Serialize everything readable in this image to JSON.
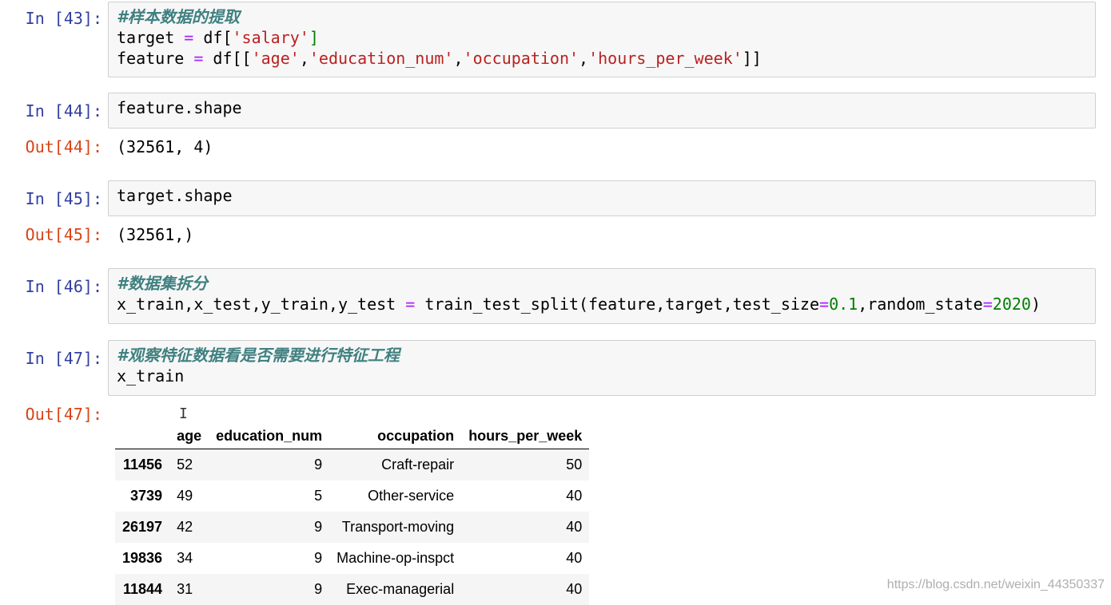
{
  "cells": {
    "c43": {
      "prompt": "In [43]:",
      "comment": "#样本数据的提取",
      "line2": {
        "a": "target ",
        "op": "=",
        "b": " df[",
        "s1": "'salary'",
        "c": "]"
      },
      "line3": {
        "a": "feature ",
        "op": "=",
        "b": " df[[",
        "s1": "'age'",
        "s2": "'education_num'",
        "s3": "'occupation'",
        "s4": "'hours_per_week'",
        "comma": ",",
        "c": "]]"
      }
    },
    "c44": {
      "prompt": "In [44]:",
      "code": "feature.shape",
      "out_prompt": "Out[44]:",
      "output": "(32561, 4)"
    },
    "c45": {
      "prompt": "In [45]:",
      "code": "target.shape",
      "out_prompt": "Out[45]:",
      "output": "(32561,)"
    },
    "c46": {
      "prompt": "In [46]:",
      "comment": "#数据集拆分",
      "a": "x_train,x_test,y_train,y_test ",
      "op": "=",
      "b": " train_test_split(feature,target,test_size",
      "eq": "=",
      "n1": "0.1",
      "c": ",random_state",
      "n2": "2020",
      "d": ")"
    },
    "c47": {
      "prompt": "In [47]:",
      "comment": "#观察特征数据看是否需要进行特征工程",
      "code": "x_train",
      "out_prompt": "Out[47]:"
    }
  },
  "table": {
    "columns": [
      "",
      "age",
      "education_num",
      "occupation",
      "hours_per_week"
    ],
    "rows": [
      [
        "11456",
        "52",
        "9",
        "Craft-repair",
        "50"
      ],
      [
        "3739",
        "49",
        "5",
        "Other-service",
        "40"
      ],
      [
        "26197",
        "42",
        "9",
        "Transport-moving",
        "40"
      ],
      [
        "19836",
        "34",
        "9",
        "Machine-op-inspct",
        "40"
      ],
      [
        "11844",
        "31",
        "9",
        "Exec-managerial",
        "40"
      ]
    ]
  },
  "watermark": "https://blog.csdn.net/weixin_44350337",
  "colors": {
    "in_prompt": "#303f9f",
    "out_prompt": "#d84315",
    "comment": "#408080",
    "string": "#ba2121",
    "number": "#008000",
    "operator": "#aa22ff"
  }
}
